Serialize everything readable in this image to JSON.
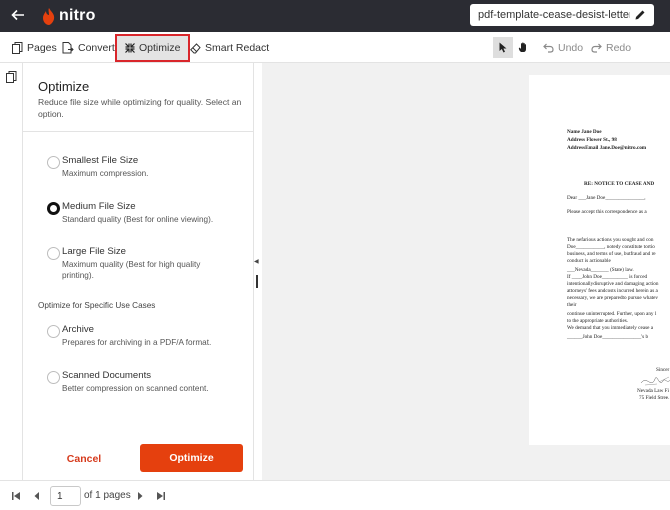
{
  "app": {
    "logo_text": "nitro",
    "filename": "pdf-template-cease-desist-letter.pdf"
  },
  "toolbar": {
    "pages_label": "Pages",
    "convert_label": "Convert",
    "optimize_label": "Optimize",
    "redact_label": "Smart Redact",
    "undo_label": "Undo",
    "redo_label": "Redo"
  },
  "panel": {
    "title": "Optimize",
    "description": "Reduce file size while optimizing for quality. Select an option.",
    "options": [
      {
        "label": "Smallest File Size",
        "sub": "Maximum compression.",
        "checked": false
      },
      {
        "label": "Medium File Size",
        "sub": "Standard quality (Best for online viewing).",
        "checked": true
      },
      {
        "label": "Large File Size",
        "sub": "Maximum quality (Best for high quality printing).",
        "checked": false
      }
    ],
    "section_label": "Optimize for Specific Use Cases",
    "use_cases": [
      {
        "label": "Archive",
        "sub": "Prepares for archiving in a PDF/A format.",
        "checked": false
      },
      {
        "label": "Scanned Documents",
        "sub": "Better compression on scanned content.",
        "checked": false
      }
    ],
    "cancel_label": "Cancel",
    "optimize_label": "Optimize"
  },
  "document": {
    "lines": [
      "Name Jane Doe",
      "Address Flower St., 98",
      "AddressEmail Jane.Doe@nitro.com",
      "RE:      NOTICE TO CEASE AND",
      "Dear ___Jane Doe_______________,",
      "Please accept this correspondence as a",
      "The nefarious actions you sought and con",
      "Doe___________, notedy constitute tortio",
      "business, and terms of use, butfraud and re",
      "conduct is actionable",
      "___Nevada_______ (State) law.",
      "If ____John Doe__________ is forced",
      "intentionallydisruptive and damaging action",
      "attorneys' fees andcosts incurred herein as a",
      "necessary, we are preparedto pursue whatev",
      "their",
      "continue uninterrupted.  Further, upon any l",
      "to the appropriate authorities.",
      "We demand that you immediately cease a",
      "______John Doe_______________'s b",
      "Sincer",
      "Nevada Law Fi",
      "75 Field Stree."
    ]
  },
  "pagination": {
    "current_page": "1",
    "of_text": "of 1 pages"
  },
  "colors": {
    "accent": "#e5400e",
    "topbar": "#2b2c33",
    "highlight": "#d9262b"
  }
}
